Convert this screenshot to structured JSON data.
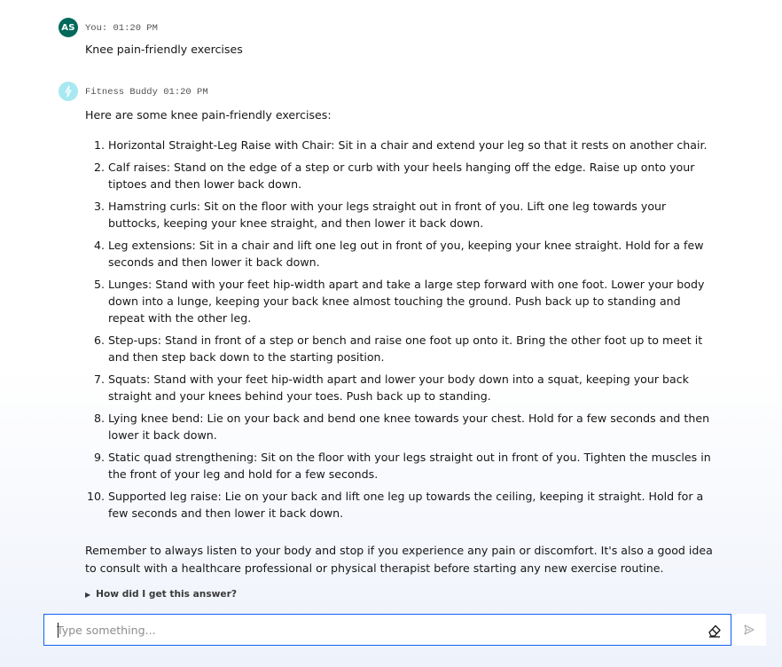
{
  "user_message": {
    "avatar_initials": "AS",
    "meta": "You: 01:20 PM",
    "text": "Knee pain-friendly exercises"
  },
  "bot_message": {
    "meta": "Fitness Buddy 01:20 PM",
    "avatar_icon": "lightning-bolt-icon",
    "intro": "Here are some knee pain-friendly exercises:",
    "items": [
      "Horizontal Straight-Leg Raise with Chair: Sit in a chair and extend your leg so that it rests on another chair.",
      "Calf raises: Stand on the edge of a step or curb with your heels hanging off the edge. Raise up onto your tiptoes and then lower back down.",
      "Hamstring curls: Sit on the floor with your legs straight out in front of you. Lift one leg towards your buttocks, keeping your knee straight, and then lower it back down.",
      "Leg extensions: Sit in a chair and lift one leg out in front of you, keeping your knee straight. Hold for a few seconds and then lower it back down.",
      "Lunges: Stand with your feet hip-width apart and take a large step forward with one foot. Lower your body down into a lunge, keeping your back knee almost touching the ground. Push back up to standing and repeat with the other leg.",
      "Step-ups: Stand in front of a step or bench and raise one foot up onto it. Bring the other foot up to meet it and then step back down to the starting position.",
      "Squats: Stand with your feet hip-width apart and lower your body down into a squat, keeping your back straight and your knees behind your toes. Push back up to standing.",
      "Lying knee bend: Lie on your back and bend one knee towards your chest. Hold for a few seconds and then lower it back down.",
      "Static quad strengthening: Sit on the floor with your legs straight out in front of you. Tighten the muscles in the front of your leg and hold for a few seconds.",
      "Supported leg raise: Lie on your back and lift one leg up towards the ceiling, keeping it straight. Hold for a few seconds and then lower it back down."
    ],
    "outro": "Remember to always listen to your body and stop if you experience any pain or discomfort. It's also a good idea to consult with a healthcare professional or physical therapist before starting any new exercise routine.",
    "details_label": "How did I get this answer?"
  },
  "composer": {
    "placeholder": "Type something...",
    "value": "",
    "clear_icon": "eraser-icon",
    "send_icon": "send-icon"
  },
  "colors": {
    "accent": "#0f62fe",
    "user_avatar_bg": "#00695c",
    "bot_avatar_bg": "#a8e8f0"
  }
}
